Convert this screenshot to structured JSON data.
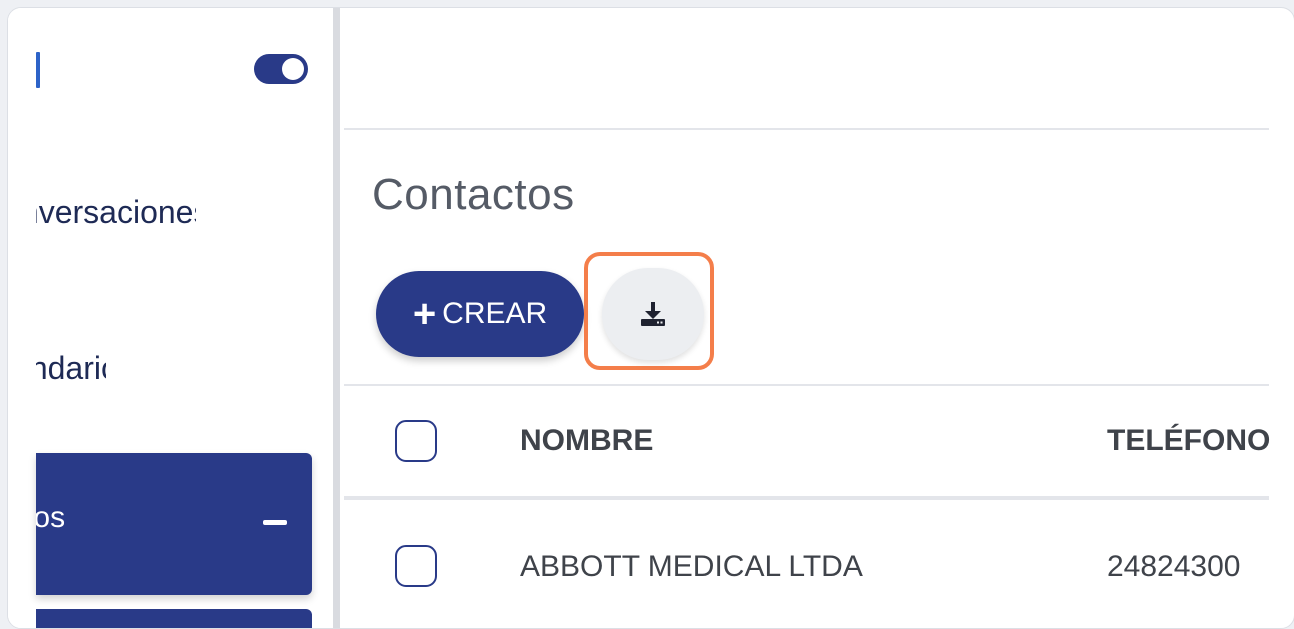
{
  "sidebar": {
    "items": [
      {
        "label": "Conversaciones"
      },
      {
        "label": "Calendario"
      }
    ],
    "active_item": {
      "label": "Contactos"
    }
  },
  "main": {
    "title": "Contactos",
    "create_label": "CREAR",
    "table": {
      "headers": {
        "name": "NOMBRE",
        "phone": "TELÉFONO"
      },
      "rows": [
        {
          "name": "ABBOTT MEDICAL LTDA",
          "phone": "24824300"
        }
      ]
    }
  },
  "icons": {
    "create": "plus-icon",
    "export": "download-icon",
    "collapse": "minus-icon"
  },
  "colors": {
    "primary": "#293a88",
    "highlight": "#f47e4a",
    "accent": "#2d63c8"
  }
}
